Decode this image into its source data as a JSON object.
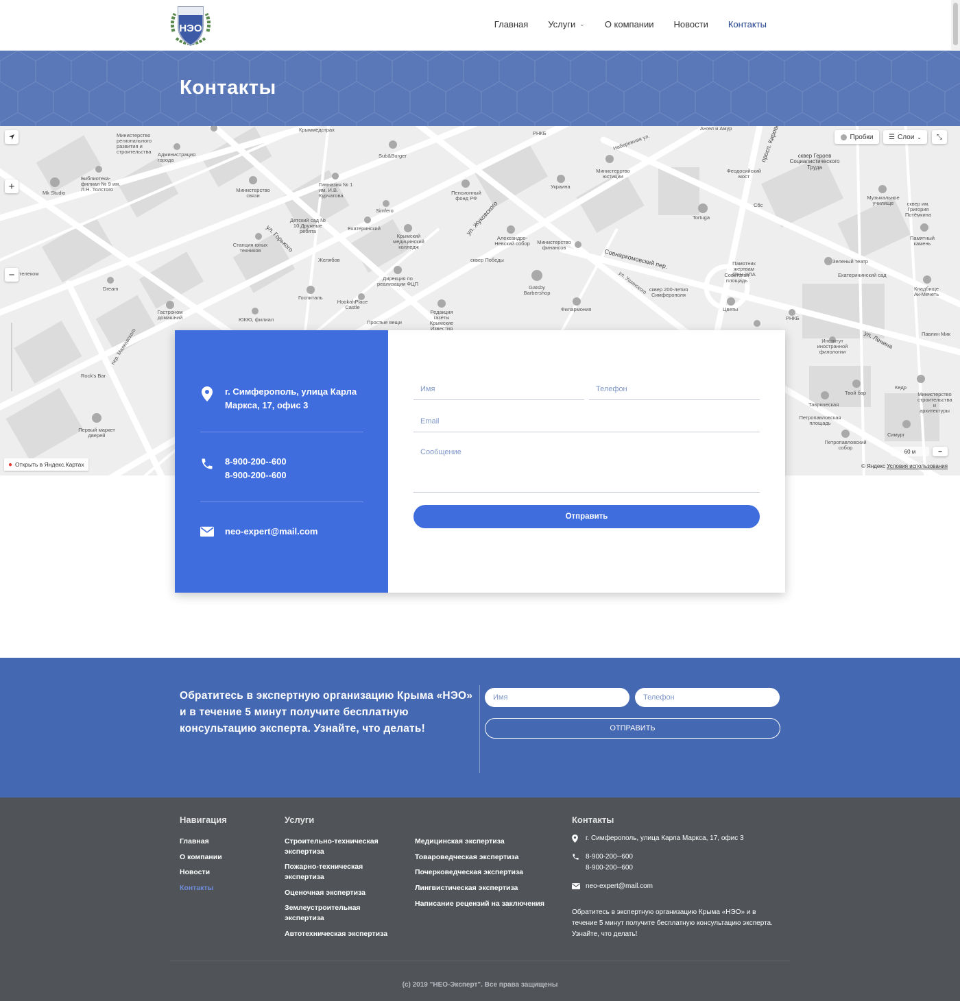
{
  "header": {
    "logo_alt": "НЭО",
    "nav": [
      "Главная",
      "Услуги",
      "О компании",
      "Новости",
      "Контакты"
    ]
  },
  "page_title": "Контакты",
  "map": {
    "labels": [
      "Крыммедстрах",
      "Министерство регионального развития и строительства",
      "Администрация города",
      "Sub&Burger",
      "Гимназия № 1 им. И.В. Курчатова",
      "Пенсионный фонд РФ",
      "Украина",
      "Министерство юстиции",
      "Набережная ул.",
      "сквер Героев Социалистического Труда",
      "Библиотека-филиал № 9 им. Л.Н. Толстого",
      "Mk Studio",
      "Министерство связи",
      "Детский сад № 10 Дружные ребята",
      "Simfero",
      "Екатеринский",
      "Крымский медицинский колледж",
      "ул. Жуковского",
      "Александро-Невский собор",
      "Министерство финансов",
      "Tortuga",
      "Музыкальное училище",
      "сквер им. Григория Потёмкина",
      "Памятный камень",
      "Станция юных техников",
      "ул. Горького",
      "Желябов",
      "Дирекция по реализации ФЦП",
      "сквер Победы",
      "Совнаркомовский пер.",
      "Памятник жертвам ОУН-УПА",
      "Советская площадь",
      "Зеленый театр",
      "Екатерининский сад",
      "Dream",
      "Госпиталь",
      "HookahPlace Castle",
      "Gatsby Barbershop",
      "сквер 200-летия Симферополя",
      "ул. Ушинского",
      "Кладбище Ак-Мечеть",
      "Гастроном домашний",
      "ЮКЮ, филиал",
      "Простые вещи",
      "Редакция газеты Крымские Известия",
      "Филармония",
      "Цветы",
      "РНКБ",
      "Институт иностранной филологии",
      "ул. Ленина",
      "Павлин Мик",
      "пер. Маяковского",
      "Rock's Bar",
      "Первый маркет дверей",
      "Твой бар",
      "Кедр",
      "Таврическая",
      "Министерство строительства и архитектуры",
      "Петропавловская площадь",
      "Симург",
      "Петропавловский собор",
      "Ангел и Амур",
      "просп. Кирова",
      "РНКБ",
      "Сбс",
      "Феодосийский мост",
      "телеком"
    ],
    "traffic_label": "Пробки",
    "layers_label": "Слои",
    "open_label": "Открыть в Яндекс.Картах",
    "scale_label": "60 м",
    "copyright": "© Яндекс",
    "terms_label": "Условия использования"
  },
  "contact": {
    "address": "г. Симферополь, улица Карла Маркса, 17, офис 3",
    "phones": [
      "8-900-200--600",
      "8-900-200--600"
    ],
    "email": "neo-expert@mail.com"
  },
  "form": {
    "name_placeholder": "Имя",
    "phone_placeholder": "Телефон",
    "email_placeholder": "Email",
    "message_placeholder": "Сообщение",
    "submit_label": "Отправить"
  },
  "cta": {
    "text": "Обратитесь в экспертную организацию Крыма «НЭО» и в течение 5 минут получите бесплатную консультацию эксперта. Узнайте, что делать!",
    "name_placeholder": "Имя",
    "phone_placeholder": "Телефон",
    "submit_label": "ОТПРАВИТЬ"
  },
  "footer": {
    "nav_title": "Навигация",
    "nav_items": [
      "Главная",
      "О компании",
      "Новости",
      "Контакты"
    ],
    "services_title": "Услуги",
    "services_col1": [
      "Строительно-техническая экспертиза",
      "Пожарно-техническая экспертиза",
      "Оценочная экспертиза",
      "Землеустроительная экспертиза",
      "Автотехническая экспертиза"
    ],
    "services_col2": [
      "Медицинская экспертиза",
      "Товароведческая экспертиза",
      "Почерковедческая экспертиза",
      "Лингвистическая экспертиза",
      "Написание рецензий на заключения"
    ],
    "contacts_title": "Контакты",
    "address": "г. Симферополь, улица Карла Маркса, 17, офис 3",
    "phones": [
      "8-900-200--600",
      "8-900-200--600"
    ],
    "email": "neo-expert@mail.com",
    "about": "Обратитесь в экспертную организацию Крыма «НЭО» и в течение 5 минут получите бесплатную консультацию эксперта. Узнайте, что делать!",
    "copyright": "(с) 2019 \"НЕО-Эксперт\". Все права защищены"
  },
  "colors": {
    "primary": "#3f6ddd",
    "title_band": "#5a78b8",
    "cta_band": "#4568b3",
    "footer": "#505458",
    "nav_active": "#1f3f8f"
  }
}
